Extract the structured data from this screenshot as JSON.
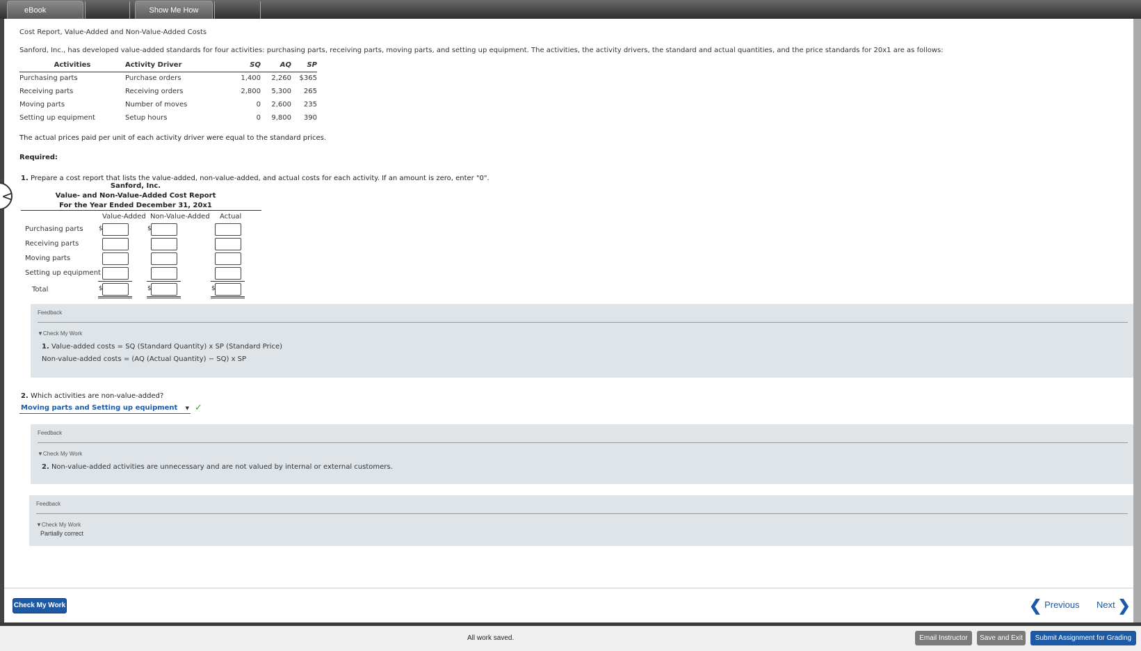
{
  "topbar": {
    "tabs": [
      "eBook",
      "Show Me How"
    ]
  },
  "page_title": "Cost Report, Value-Added and Non-Value-Added Costs",
  "intro": "Sanford, Inc., has developed value-added standards for four activities: purchasing parts, receiving parts, moving parts, and setting up equipment. The activities, the activity drivers, the standard and actual quantities, and the price standards for 20x1 are as follows:",
  "data_table": {
    "headers": [
      "Activities",
      "Activity Driver",
      "SQ",
      "AQ",
      "SP"
    ],
    "rows": [
      [
        "Purchasing parts",
        "Purchase orders",
        "1,400",
        "2,260",
        "$365"
      ],
      [
        "Receiving parts",
        "Receiving orders",
        "2,800",
        "5,300",
        "265"
      ],
      [
        "Moving parts",
        "Number of moves",
        "0",
        "2,600",
        "235"
      ],
      [
        "Setting up equipment",
        "Setup hours",
        "0",
        "9,800",
        "390"
      ]
    ]
  },
  "price_note": "The actual prices paid per unit of each activity driver were equal to the standard prices.",
  "required_label": "Required:",
  "q1": {
    "number": "1.",
    "text": " Prepare a cost report that lists the value-added, non-value-added, and actual costs for each activity. If an amount is zero, enter \"0\".",
    "report": {
      "company": "Sanford, Inc.",
      "title": "Value- and Non-Value-Added Cost Report",
      "period": "For the Year Ended December 31, 20x1",
      "columns": [
        "Value-Added",
        "Non-Value-Added",
        "Actual"
      ],
      "rows": [
        "Purchasing parts",
        "Receiving parts",
        "Moving parts",
        "Setting up equipment"
      ],
      "total_label": "Total",
      "currency_symbol": "$"
    },
    "feedback": {
      "label": "Feedback",
      "check_label": "Check My Work",
      "lines": [
        {
          "num": "1.",
          "text": " Value-added costs = SQ (Standard Quantity) x SP (Standard Price)"
        },
        {
          "num": "",
          "text": "Non-value-added costs = (AQ (Actual Quantity) − SQ) x SP"
        }
      ]
    }
  },
  "q2": {
    "number": "2.",
    "text": " Which activities are non-value-added?",
    "selected": "Moving parts and Setting up equipment",
    "checkmark": "✓",
    "feedback": {
      "label": "Feedback",
      "check_label": "Check My Work",
      "num": "2.",
      "text": " Non-value-added activities are unnecessary and are not valued by internal or external customers."
    }
  },
  "overall_feedback": {
    "label": "Feedback",
    "check_label": "Check My Work",
    "result": "Partially correct"
  },
  "bottom": {
    "check_button": "Check My Work",
    "previous": "Previous",
    "next": "Next"
  },
  "footer": {
    "status": "All work saved.",
    "email": "Email Instructor",
    "save_exit": "Save and Exit",
    "submit": "Submit Assignment for Grading"
  },
  "colors": {
    "accent": "#1d5aa6",
    "feedback_bg": "#dfe4e8",
    "check_green": "#3a9b2e",
    "button_gray": "#7a7a7a"
  }
}
